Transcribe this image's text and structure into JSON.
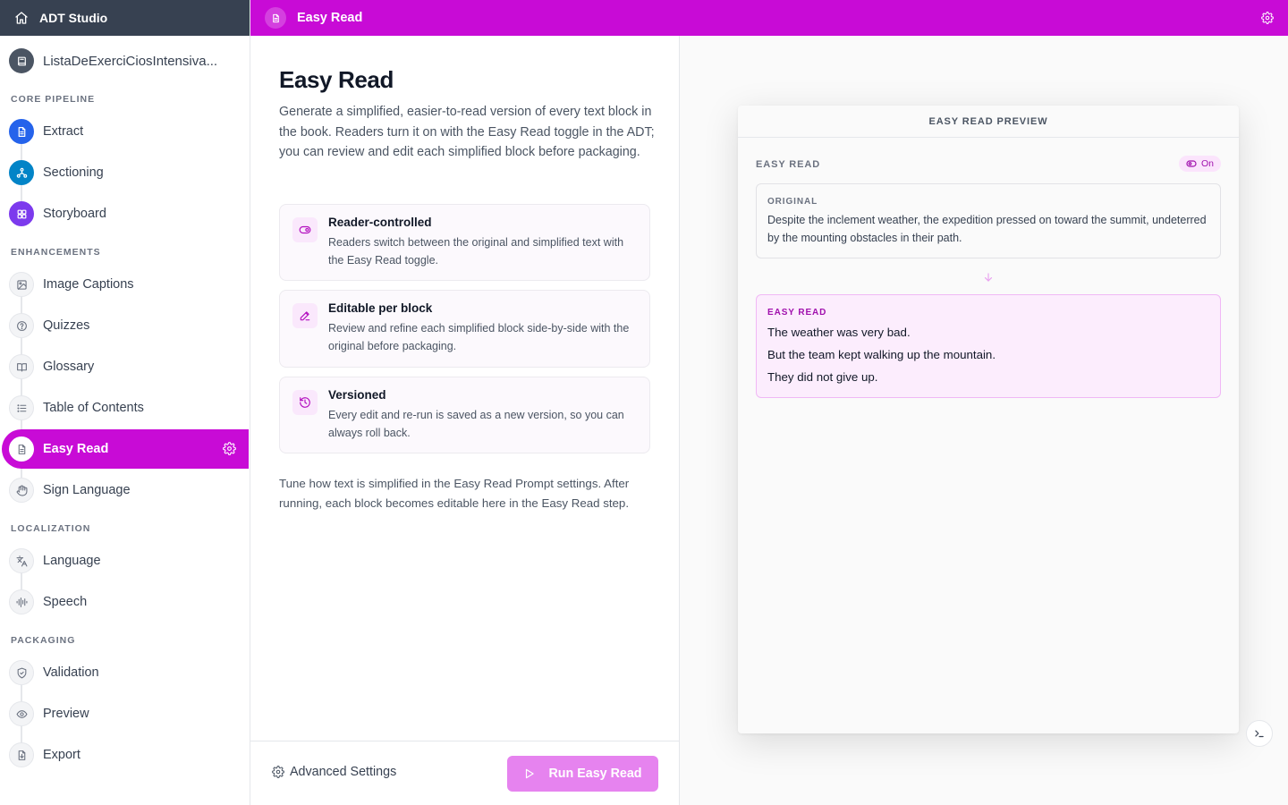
{
  "app": {
    "title": "ADT Studio"
  },
  "book": {
    "name": "ListaDeExerciCiosIntensiva..."
  },
  "sidebar": {
    "sections": [
      {
        "label": "CORE PIPELINE"
      },
      {
        "label": "ENHANCEMENTS"
      },
      {
        "label": "LOCALIZATION"
      },
      {
        "label": "PACKAGING"
      }
    ],
    "items": [
      {
        "label": "Extract",
        "icon": "file-text-icon",
        "color": "#2563eb"
      },
      {
        "label": "Sectioning",
        "icon": "sitemap-icon",
        "color": "#0284c7"
      },
      {
        "label": "Storyboard",
        "icon": "grid-icon",
        "color": "#7c3aed"
      },
      {
        "label": "Image Captions",
        "icon": "image-icon"
      },
      {
        "label": "Quizzes",
        "icon": "question-icon"
      },
      {
        "label": "Glossary",
        "icon": "book-open-icon"
      },
      {
        "label": "Table of Contents",
        "icon": "list-icon"
      },
      {
        "label": "Easy Read",
        "icon": "file-text-icon",
        "active": true,
        "color": "#c80bd6"
      },
      {
        "label": "Sign Language",
        "icon": "hand-icon"
      },
      {
        "label": "Language",
        "icon": "translate-icon"
      },
      {
        "label": "Speech",
        "icon": "audio-wave-icon"
      },
      {
        "label": "Validation",
        "icon": "shield-check-icon"
      },
      {
        "label": "Preview",
        "icon": "eye-icon"
      },
      {
        "label": "Export",
        "icon": "file-export-icon"
      }
    ]
  },
  "topbar": {
    "title": "Easy Read",
    "accent": "#c80bd6"
  },
  "main": {
    "title": "Easy Read",
    "description": "Generate a simplified, easier-to-read version of every text block in the book. Readers turn it on with the Easy Read toggle in the ADT; you can review and edit each simplified block before packaging.",
    "features": [
      {
        "title": "Reader-controlled",
        "text": "Readers switch between the original and simplified text with the Easy Read toggle.",
        "icon": "toggle-icon"
      },
      {
        "title": "Editable per block",
        "text": "Review and refine each simplified block side-by-side with the original before packaging.",
        "icon": "pencil-icon"
      },
      {
        "title": "Versioned",
        "text": "Every edit and re-run is saved as a new version, so you can always roll back.",
        "icon": "history-icon"
      }
    ],
    "note": "Tune how text is simplified in the Easy Read Prompt settings. After running, each block becomes editable here in the Easy Read step."
  },
  "footer": {
    "advanced_label": "Advanced Settings",
    "run_label": "Run Easy Read"
  },
  "preview": {
    "header": "EASY READ PREVIEW",
    "section_label": "EASY READ",
    "toggle_label": "On",
    "original_label": "ORIGINAL",
    "original_text": "Despite the inclement weather, the expedition pressed on toward the summit, undeterred by the mounting obstacles in their path.",
    "easy_label": "EASY READ",
    "easy_lines": [
      "The weather was very bad.",
      "But the team kept walking up the mountain.",
      "They did not give up."
    ]
  }
}
